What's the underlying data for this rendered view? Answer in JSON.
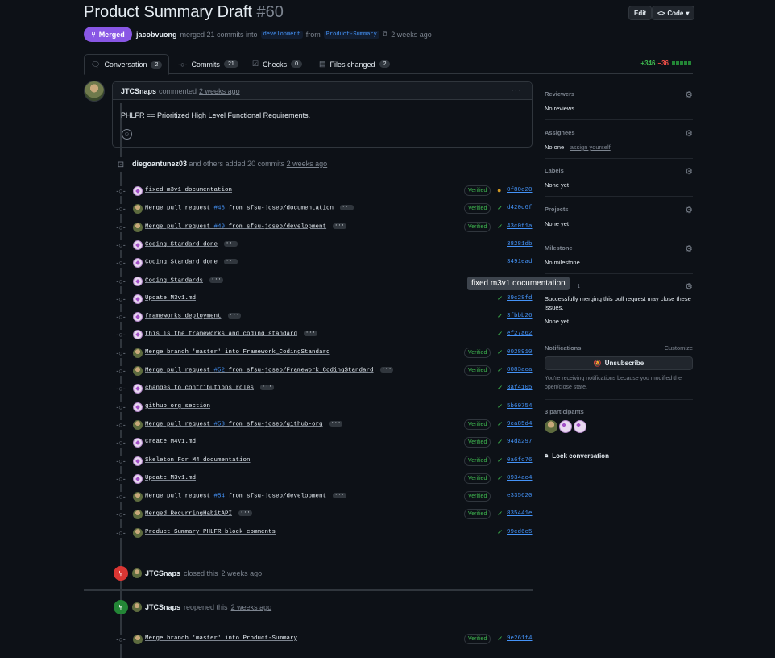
{
  "pr": {
    "title": "Product Summary Draft",
    "number": "#60",
    "status": "Merged",
    "author": "jacobvuong",
    "merge_text": "merged 21 commits into",
    "base_branch": "development",
    "from_text": "from",
    "head_branch": "Product-Summary",
    "time": "2 weeks ago"
  },
  "header": {
    "edit_label": "Edit",
    "code_label": "Code"
  },
  "tabs": [
    {
      "label": "Conversation",
      "count": "2",
      "icon": "conversation-icon"
    },
    {
      "label": "Commits",
      "count": "21",
      "icon": "commit-icon"
    },
    {
      "label": "Checks",
      "count": "0",
      "icon": "checks-icon"
    },
    {
      "label": "Files changed",
      "count": "2",
      "icon": "file-diff-icon"
    }
  ],
  "diffstat": {
    "additions": "+346",
    "deletions": "−36"
  },
  "comment": {
    "author": "JTCSnaps",
    "action": "commented",
    "time": "2 weeks ago",
    "body": "PHLFR == Prioritized High Level Functional Requirements."
  },
  "push_event": {
    "author": "diegoantunez03",
    "text": "and others added 20 commits",
    "time": "2 weeks ago"
  },
  "commits": [
    {
      "message": "fixed m3v1 documentation",
      "pr": "",
      "suffix": "",
      "more": false,
      "verified": true,
      "status": "pending",
      "sha": "0f80e20",
      "avatar": "b"
    },
    {
      "message": "Merge pull request ",
      "pr": "#48",
      "suffix": " from sfsu-joseo/documentation",
      "more": true,
      "verified": true,
      "status": "ok",
      "sha": "d420d6f",
      "avatar": "a"
    },
    {
      "message": "Merge pull request ",
      "pr": "#49",
      "suffix": " from sfsu-joseo/development",
      "more": true,
      "verified": true,
      "status": "ok",
      "sha": "43c0f1a",
      "avatar": "a"
    },
    {
      "message": "Coding Standard done",
      "pr": "",
      "suffix": "",
      "more": true,
      "verified": false,
      "status": "",
      "sha": "38281db",
      "avatar": "b"
    },
    {
      "message": "Coding Standard done",
      "pr": "",
      "suffix": "",
      "more": true,
      "verified": false,
      "status": "",
      "sha": "3491ead",
      "avatar": "b"
    },
    {
      "message": "Coding Standards",
      "pr": "",
      "suffix": "",
      "more": true,
      "verified": false,
      "status": "",
      "sha": "",
      "avatar": "b"
    },
    {
      "message": "Update M3v1.md",
      "pr": "",
      "suffix": "",
      "more": false,
      "verified": false,
      "status": "ok",
      "sha": "39c28fd",
      "avatar": "b"
    },
    {
      "message": "frameworks deployment",
      "pr": "",
      "suffix": "",
      "more": true,
      "verified": false,
      "status": "ok",
      "sha": "3fbbb26",
      "avatar": "b"
    },
    {
      "message": "this is the frameworks and coding standard",
      "pr": "",
      "suffix": "",
      "more": true,
      "verified": false,
      "status": "ok",
      "sha": "ef27a62",
      "avatar": "b"
    },
    {
      "message": "Merge branch 'master' into Framework_CodingStandard",
      "pr": "",
      "suffix": "",
      "more": false,
      "verified": true,
      "status": "ok",
      "sha": "0028910",
      "avatar": "a"
    },
    {
      "message": "Merge pull request ",
      "pr": "#52",
      "suffix": " from sfsu-joseo/Framework_CodingStandard",
      "more": true,
      "verified": true,
      "status": "ok",
      "sha": "0083aca",
      "avatar": "a"
    },
    {
      "message": "changes to contributions roles",
      "pr": "",
      "suffix": "",
      "more": true,
      "verified": false,
      "status": "ok",
      "sha": "3af4105",
      "avatar": "b"
    },
    {
      "message": "github org section",
      "pr": "",
      "suffix": "",
      "more": false,
      "verified": false,
      "status": "ok",
      "sha": "5b60754",
      "avatar": "b"
    },
    {
      "message": "Merge pull request ",
      "pr": "#53",
      "suffix": " from sfsu-joseo/github-org",
      "more": true,
      "verified": true,
      "status": "ok",
      "sha": "9ca85d4",
      "avatar": "a"
    },
    {
      "message": "Create M4v1.md",
      "pr": "",
      "suffix": "",
      "more": false,
      "verified": true,
      "status": "ok",
      "sha": "94da297",
      "avatar": "b"
    },
    {
      "message": "Skeleton For M4 documentation",
      "pr": "",
      "suffix": "",
      "more": false,
      "verified": true,
      "status": "ok",
      "sha": "0a6fc76",
      "avatar": "b"
    },
    {
      "message": "Update M3v1.md",
      "pr": "",
      "suffix": "",
      "more": false,
      "verified": true,
      "status": "ok",
      "sha": "0934ac4",
      "avatar": "b"
    },
    {
      "message": "Merge pull request ",
      "pr": "#54",
      "suffix": " from sfsu-joseo/development",
      "more": true,
      "verified": true,
      "status": "",
      "sha": "e335620",
      "avatar": "a"
    },
    {
      "message": "Merged RecurringHabitAPI",
      "pr": "",
      "suffix": "",
      "more": true,
      "verified": true,
      "status": "ok",
      "sha": "835441e",
      "avatar": "a"
    },
    {
      "message": "Product Summary PHLFR block comments",
      "pr": "",
      "suffix": "",
      "more": false,
      "verified": false,
      "status": "ok",
      "sha": "99cd6c5",
      "avatar": "a"
    }
  ],
  "closed_event": {
    "author": "JTCSnaps",
    "text": "closed this",
    "time": "2 weeks ago"
  },
  "reopened_event": {
    "author": "JTCSnaps",
    "text": "reopened this",
    "time": "2 weeks ago"
  },
  "last_commit": {
    "message": "Merge branch 'master' into Product-Summary",
    "verified_label": "Verified",
    "sha": "9e261f4"
  },
  "verified_label": "Verified",
  "tooltip": "fixed m3v1 documentation",
  "sidebar": {
    "reviewers": {
      "title": "Reviewers",
      "value": "No reviews"
    },
    "assignees": {
      "title": "Assignees",
      "value": "No one—",
      "link": "assign yourself"
    },
    "labels": {
      "title": "Labels",
      "value": "None yet"
    },
    "projects": {
      "title": "Projects",
      "value": "None yet"
    },
    "milestone": {
      "title": "Milestone",
      "value": "No milestone"
    },
    "development": {
      "title_tail": "t",
      "note": "Successfully merging this pull request may close these issues.",
      "value": "None yet"
    },
    "notifications": {
      "title": "Notifications",
      "customize": "Customize",
      "button": "Unsubscribe",
      "note": "You're receiving notifications because you modified the open/close state."
    },
    "participants": {
      "title": "3 participants"
    },
    "lock": "Lock conversation"
  },
  "colors": {
    "merged": "#8957e5",
    "closed": "#da3633",
    "open": "#238636",
    "link": "#4493f8",
    "success": "#3fb950"
  }
}
